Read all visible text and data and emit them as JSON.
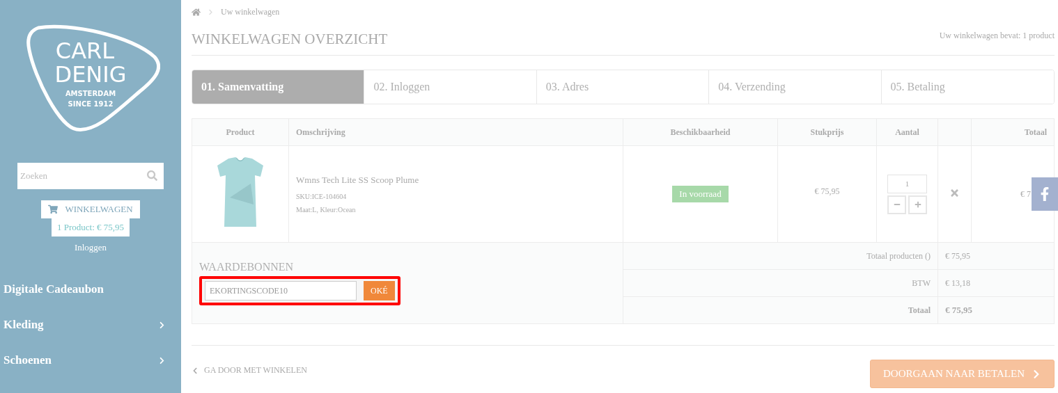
{
  "sidebar": {
    "logo": {
      "lines": [
        "CARL",
        "DENIG",
        "AMSTERDAM",
        "SINCE 1912"
      ]
    },
    "search": {
      "placeholder": "Zoeken"
    },
    "cart": {
      "label": "WINKELWAGEN",
      "summary": "1 Product: € 75,95"
    },
    "login": "Inloggen",
    "menu": [
      {
        "label": "Digitale Cadeaubon",
        "has_children": false
      },
      {
        "label": "Kleding",
        "has_children": true
      },
      {
        "label": "Schoenen",
        "has_children": true
      }
    ]
  },
  "breadcrumb": [
    "Uw winkelwagen"
  ],
  "page_title": "WINKELWAGEN OVERZICHT",
  "cart_count": "Uw winkelwagen bevat: 1 product",
  "steps": [
    {
      "label": "01. Samenvatting",
      "selected": true
    },
    {
      "label": "02. Inloggen",
      "selected": false
    },
    {
      "label": "03. Adres",
      "selected": false
    },
    {
      "label": "04. Verzending",
      "selected": false
    },
    {
      "label": "05. Betaling",
      "selected": false
    }
  ],
  "table": {
    "columns": [
      "Product",
      "Omschrijving",
      "Beschikbaarheid",
      "Stukprijs",
      "Aantal",
      "",
      "Totaal"
    ],
    "rows": [
      {
        "kind": "picture",
        "name": "Wmns Tech Lite SS Scoop Plume",
        "sku": "SKU:ICE-104604",
        "attributes": "Maat:L, Kleur:Ocean",
        "availability": "In voorraad",
        "unit_price": "€ 75,95",
        "quantity": "1",
        "total": "€ 7"
      }
    ],
    "summary": [
      {
        "label": "Totaal producten ()",
        "value": "€ 75,95",
        "bold": false
      },
      {
        "label": "BTW",
        "value": "€ 13,18",
        "bold": false
      },
      {
        "label": "Totaal",
        "value": "€ 75,95",
        "bold": true
      }
    ]
  },
  "vouchers": {
    "title": "WAARDEBONNEN",
    "code": "EKORTINGSCODE10",
    "button": "OKÉ",
    "highlighted": true
  },
  "continue_link": "GA DOOR MET WINKELEN",
  "checkout_button": "DOORGAAN NAAR BETALEN"
}
